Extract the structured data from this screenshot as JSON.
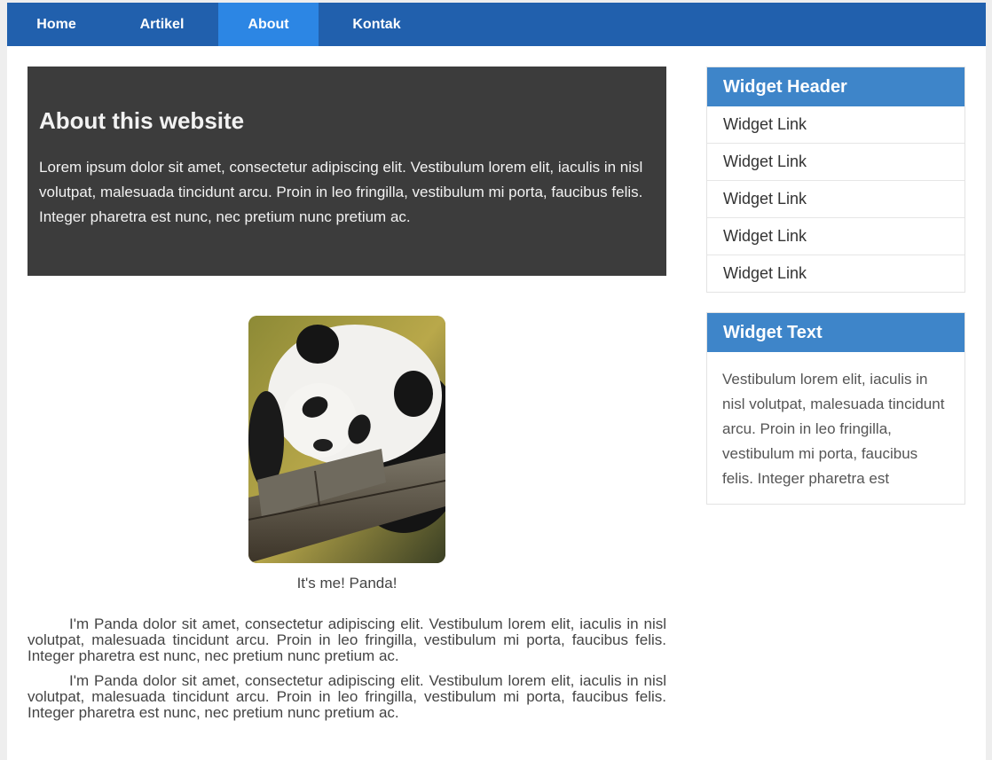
{
  "nav": {
    "items": [
      {
        "label": "Home",
        "active": false
      },
      {
        "label": "Artikel",
        "active": false
      },
      {
        "label": "About",
        "active": true
      },
      {
        "label": "Kontak",
        "active": false
      }
    ]
  },
  "hero": {
    "title": "About this website",
    "text": "Lorem ipsum dolor sit amet, consectetur adipiscing elit. Vestibulum lorem elit, iaculis in nisl volutpat, malesuada tincidunt arcu. Proin in leo fringilla, vestibulum mi porta, faucibus felis. Integer pharetra est nunc, nec pretium nunc pretium ac."
  },
  "profile": {
    "caption": "It's me! Panda!",
    "paragraphs": [
      "I'm Panda dolor sit amet, consectetur adipiscing elit. Vestibulum lorem elit, iaculis in nisl volutpat, malesuada tincidunt arcu. Proin in leo fringilla, vestibulum mi porta, faucibus felis. Integer pharetra est nunc, nec pretium nunc pretium ac.",
      "I'm Panda dolor sit amet, consectetur adipiscing elit. Vestibulum lorem elit, iaculis in nisl volutpat, malesuada tincidunt arcu. Proin in leo fringilla, vestibulum mi porta, faucibus felis. Integer pharetra est nunc, nec pretium nunc pretium ac."
    ]
  },
  "sidebar": {
    "links_widget": {
      "header": "Widget Header",
      "links": [
        "Widget Link",
        "Widget Link",
        "Widget Link",
        "Widget Link",
        "Widget Link"
      ]
    },
    "text_widget": {
      "header": "Widget Text",
      "text": "Vestibulum lorem elit, iaculis in nisl volutpat, malesuada tincidunt arcu. Proin in leo fringilla, vestibulum mi porta, faucibus felis. Integer pharetra est"
    }
  },
  "colors": {
    "navbar": "#2160ad",
    "nav_active": "#2c86e4",
    "hero_bg": "#3c3c3c",
    "widget_header": "#3e85c9"
  }
}
